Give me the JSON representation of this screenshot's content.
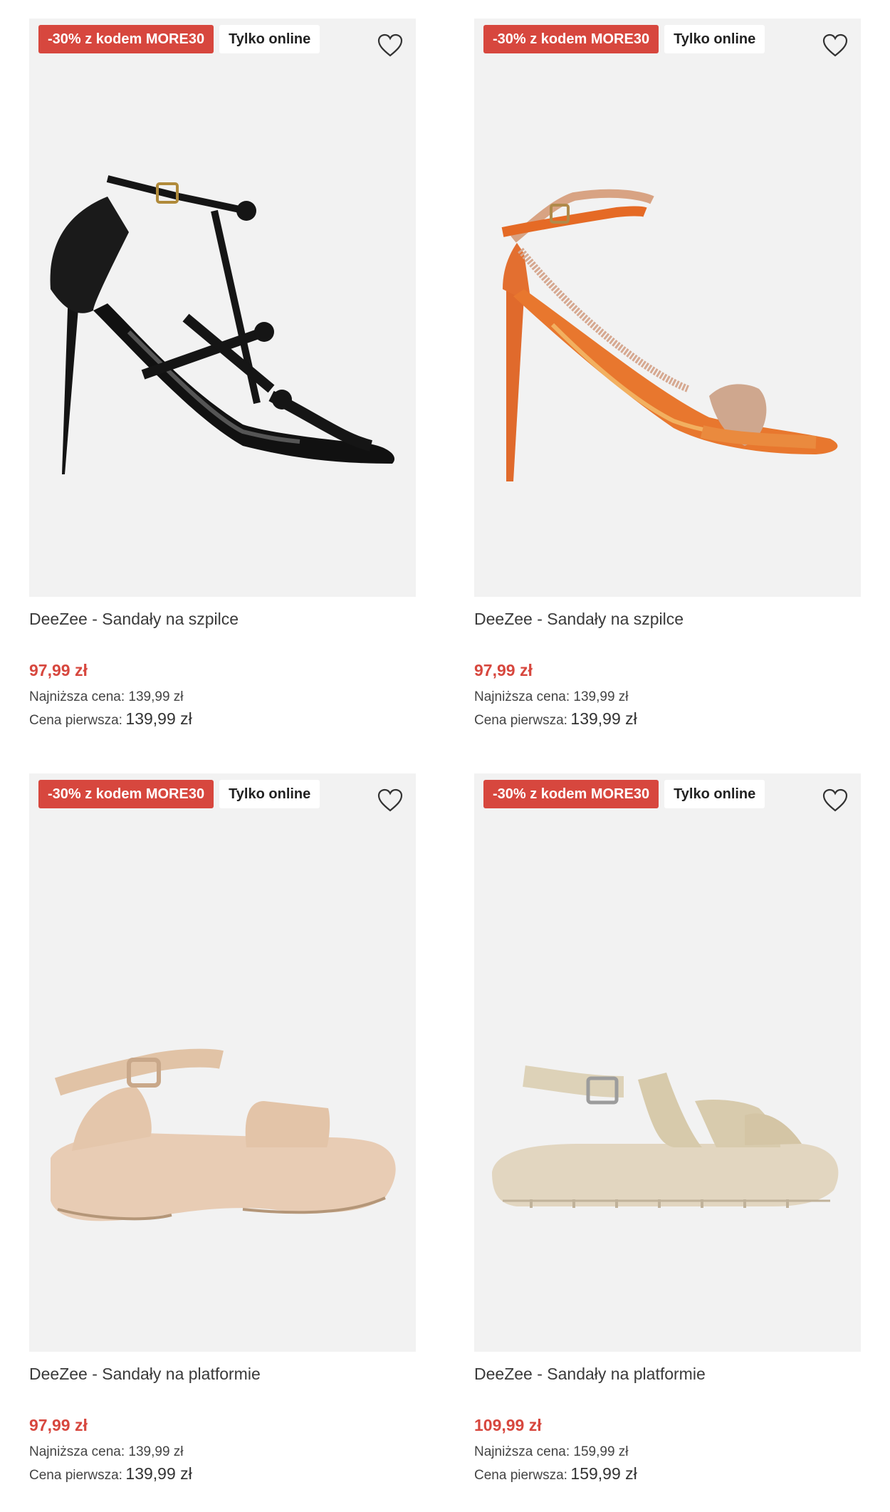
{
  "products": [
    {
      "promo_badge": "-30% z kodem MORE30",
      "online_badge": "Tylko online",
      "image_icon": "black-strappy-stiletto-sandal",
      "title": "DeeZee - Sandały na szpilce",
      "price": "97,99 zł",
      "lowest_price": "Najniższa cena: 139,99 zł",
      "first_price_label": "Cena pierwsza:",
      "first_price_value": "139,99 zł"
    },
    {
      "promo_badge": "-30% z kodem MORE30",
      "online_badge": "Tylko online",
      "image_icon": "orange-stiletto-sandal",
      "title": "DeeZee - Sandały na szpilce",
      "price": "97,99 zł",
      "lowest_price": "Najniższa cena: 139,99 zł",
      "first_price_label": "Cena pierwsza:",
      "first_price_value": "139,99 zł"
    },
    {
      "promo_badge": "-30% z kodem MORE30",
      "online_badge": "Tylko online",
      "image_icon": "beige-platform-sandal",
      "title": "DeeZee - Sandały na platformie",
      "price": "97,99 zł",
      "lowest_price": "Najniższa cena: 139,99 zł",
      "first_price_label": "Cena pierwsza:",
      "first_price_value": "139,99 zł"
    },
    {
      "promo_badge": "-30% z kodem MORE30",
      "online_badge": "Tylko online",
      "image_icon": "sand-chunky-platform-sandal",
      "title": "DeeZee - Sandały na platformie",
      "price": "109,99 zł",
      "lowest_price": "Najniższa cena: 159,99 zł",
      "first_price_label": "Cena pierwsza:",
      "first_price_value": "159,99 zł"
    }
  ],
  "colors": {
    "promo": "#d7473e",
    "image_bg": "#f2f2f2",
    "price": "#d7473e"
  }
}
